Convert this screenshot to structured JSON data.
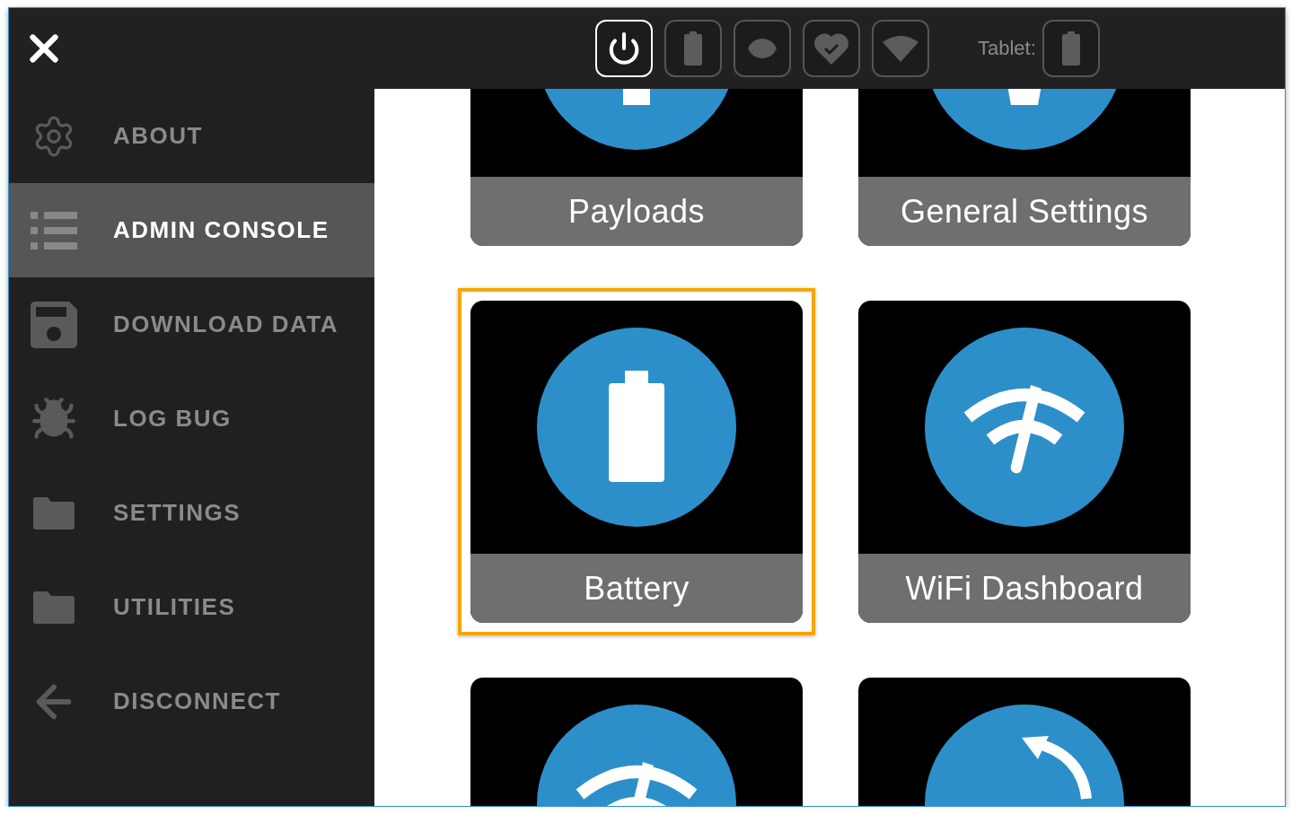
{
  "top_bar": {
    "status_buttons": [
      {
        "selected": true
      },
      {
        "selected": false
      },
      {
        "selected": false
      },
      {
        "selected": false
      },
      {
        "selected": false
      }
    ],
    "tablet_label": "Tablet:",
    "tablet_button": {
      "selected": false
    }
  },
  "sidebar": {
    "items": [
      {
        "label": "ABOUT",
        "selected": false
      },
      {
        "label": "ADMIN CONSOLE",
        "selected": true
      },
      {
        "label": "DOWNLOAD DATA",
        "selected": false
      },
      {
        "label": "LOG BUG",
        "selected": false
      },
      {
        "label": "SETTINGS",
        "selected": false
      },
      {
        "label": "UTILITIES",
        "selected": false
      },
      {
        "label": "DISCONNECT",
        "selected": false
      }
    ]
  },
  "tiles": [
    {
      "label": "Payloads",
      "selected": false
    },
    {
      "label": "General Settings",
      "selected": false
    },
    {
      "label": "Battery",
      "selected": true
    },
    {
      "label": "WiFi Dashboard",
      "selected": false
    },
    {
      "selected": false
    },
    {
      "selected": false
    }
  ]
}
